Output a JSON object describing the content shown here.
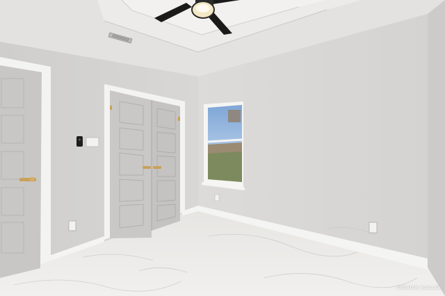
{
  "photo": {
    "subject": "empty-bedroom-interior",
    "watermark": "GREATER McALLEN",
    "colors": {
      "wall": "#d9d8d6",
      "ceiling": "#e4e3e1",
      "door": "#c9c8c6",
      "trim": "#f3f3f1",
      "floor": "#ecebe8",
      "fan": "#1a1a1a",
      "hardware": "#c9a15a"
    }
  }
}
